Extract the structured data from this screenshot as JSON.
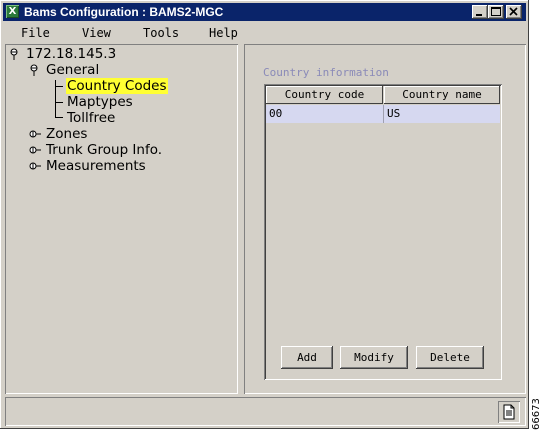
{
  "window": {
    "title": "Bams Configuration : BAMS2-MGC",
    "app_icon_letter": "X",
    "controls": [
      "minimize",
      "maximize",
      "close"
    ]
  },
  "menu": {
    "items": [
      "File",
      "View",
      "Tools",
      "Help"
    ]
  },
  "tree": {
    "root": "172.18.145.3",
    "general": "General",
    "general_children": [
      "Country Codes",
      "Maptypes",
      "Tollfree"
    ],
    "selected": "Country Codes",
    "others": [
      "Zones",
      "Trunk Group Info.",
      "Measurements"
    ]
  },
  "country_panel": {
    "section_title": "Country information",
    "columns": [
      "Country code",
      "Country name"
    ],
    "rows": [
      {
        "code": "00",
        "name": "US"
      }
    ],
    "buttons": {
      "add": "Add",
      "modify": "Modify",
      "delete": "Delete"
    }
  },
  "figure_id": "66673",
  "colors": {
    "titlebar": "#0a246a",
    "window_bg": "#d4d0c8",
    "selection_highlight": "#ffff33",
    "selected_row": "#d6d8f0",
    "section_title": "#8a8ab8"
  }
}
